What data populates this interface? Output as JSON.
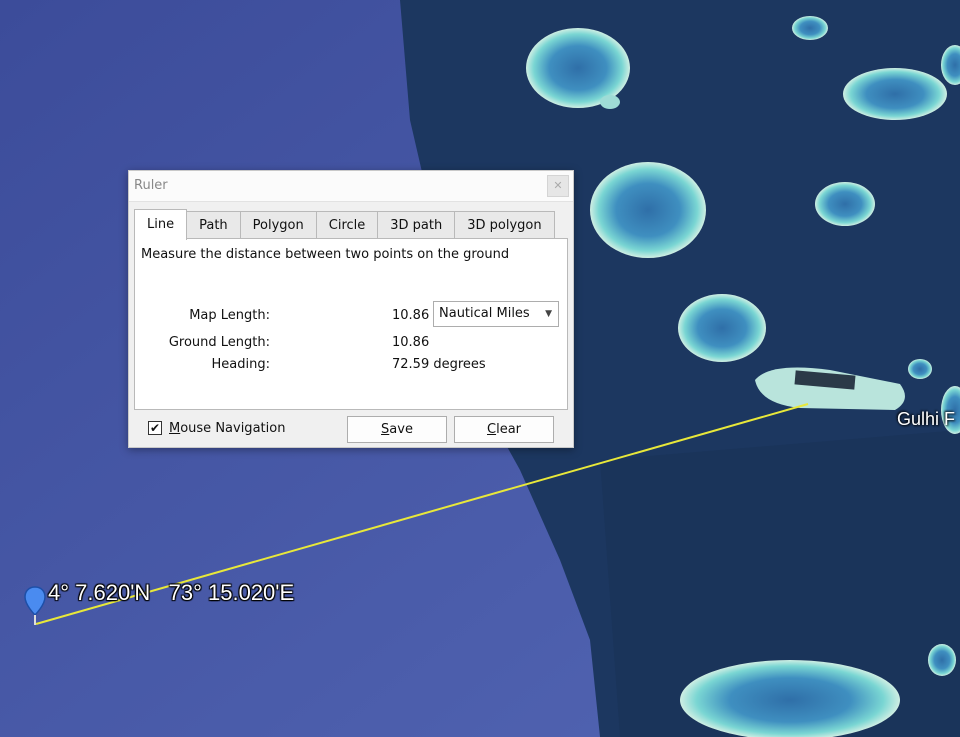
{
  "map": {
    "place_label": "Gulhi F",
    "marker_coordinates": "4° 7.620'N   73° 15.020'E",
    "measure_line_color": "#e8e83a",
    "deep_water_color": "#4a5aa6",
    "reef_color": "#5ec7c9",
    "pin_icon": "location-pin-icon"
  },
  "ruler": {
    "title": "Ruler",
    "close_icon": "close-icon",
    "tabs": [
      "Line",
      "Path",
      "Polygon",
      "Circle",
      "3D path",
      "3D polygon"
    ],
    "active_tab": "Line",
    "description": "Measure the distance between two points on the ground",
    "map_length_label": "Map Length:",
    "map_length_value": "10.86",
    "units_selected": "Nautical Miles",
    "ground_length_label": "Ground Length:",
    "ground_length_value": "10.86",
    "heading_label": "Heading:",
    "heading_value": "72.59 degrees",
    "mouse_nav_label_first": "M",
    "mouse_nav_label_rest": "ouse Navigation",
    "mouse_nav_checked": true,
    "save_first": "S",
    "save_rest": "ave",
    "clear_first": "C",
    "clear_rest": "lear"
  }
}
